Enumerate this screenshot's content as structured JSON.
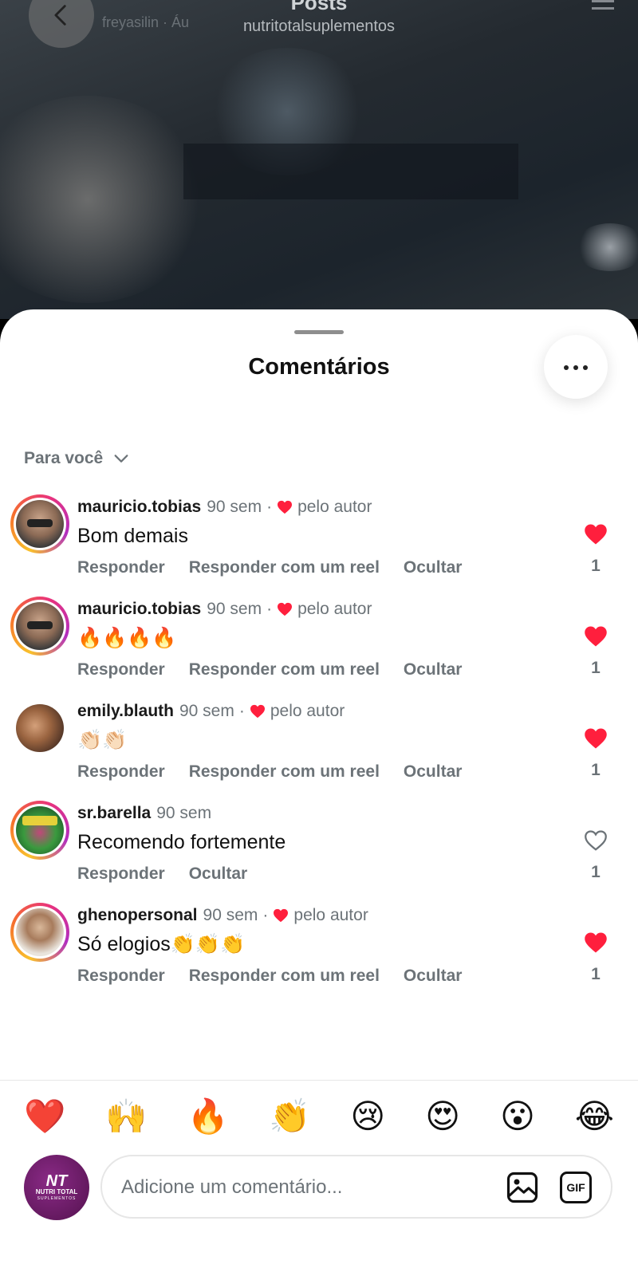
{
  "header": {
    "title": "Posts",
    "subtitle": "nutritotalsuplementos",
    "overlay_text": "freyasilin · Áu"
  },
  "sheet": {
    "title": "Comentários",
    "filter_label": "Para você"
  },
  "comments": [
    {
      "user": "mauricio.tobias",
      "time": "90 sem",
      "liked_by_author": true,
      "author_label": "pelo autor",
      "text": "Bom demais",
      "actions": [
        "Responder",
        "Responder com um reel",
        "Ocultar"
      ],
      "liked": true,
      "likes": "1"
    },
    {
      "user": "mauricio.tobias",
      "time": "90 sem",
      "liked_by_author": true,
      "author_label": "pelo autor",
      "text": "🔥🔥🔥🔥",
      "actions": [
        "Responder",
        "Responder com um reel",
        "Ocultar"
      ],
      "liked": true,
      "likes": "1"
    },
    {
      "user": "emily.blauth",
      "time": "90 sem",
      "liked_by_author": true,
      "author_label": "pelo autor",
      "text": "👏🏻👏🏻",
      "actions": [
        "Responder",
        "Responder com um reel",
        "Ocultar"
      ],
      "liked": true,
      "likes": "1"
    },
    {
      "user": "sr.barella",
      "time": "90 sem",
      "liked_by_author": false,
      "author_label": "",
      "text": "Recomendo fortemente",
      "actions": [
        "Responder",
        "Ocultar"
      ],
      "liked": false,
      "likes": "1"
    },
    {
      "user": "ghenopersonal",
      "time": "90 sem",
      "liked_by_author": true,
      "author_label": "pelo autor",
      "text": "Só elogios👏👏👏",
      "actions": [
        "Responder",
        "Responder com um reel",
        "Ocultar"
      ],
      "liked": true,
      "likes": "1"
    }
  ],
  "reactions": [
    "❤️",
    "🙌",
    "🔥",
    "👏",
    "😢",
    "😍",
    "😮",
    "😂"
  ],
  "composer": {
    "placeholder": "Adicione um comentário...",
    "avatar_logo": "NT",
    "avatar_brand": "NUTRI TOTAL",
    "avatar_brand_sub": "SUPLEMENTOS",
    "gif_label": "GIF"
  },
  "colors": {
    "heart_red": "#ff1f3d",
    "muted_text": "#6c7378"
  }
}
